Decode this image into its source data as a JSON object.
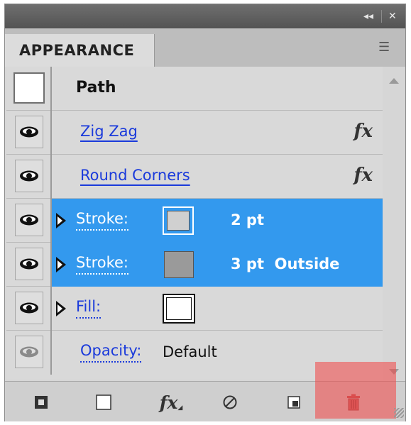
{
  "panel": {
    "collapse_glyph": "◂◂",
    "close_glyph": "✕",
    "tab_label": "APPEARANCE",
    "menu_glyph": "☰"
  },
  "header": {
    "title": "Path"
  },
  "rows": [
    {
      "kind": "effect",
      "label": "Zig Zag",
      "fx": "fx"
    },
    {
      "kind": "effect",
      "label": "Round Corners",
      "fx": "fx"
    },
    {
      "kind": "stroke",
      "label": "Stroke:",
      "value": "2 pt",
      "swatch": "#d0d0d0",
      "selected": true
    },
    {
      "kind": "stroke",
      "label": "Stroke:",
      "value": "3 pt  Outside",
      "swatch": "#9a9a9a",
      "selected": true
    },
    {
      "kind": "fill",
      "label": "Fill:",
      "swatch": "#ffffff"
    },
    {
      "kind": "opacity",
      "label": "Opacity:",
      "value": "Default"
    }
  ],
  "colors": {
    "selection": "#3399ee",
    "link": "#1a3adb",
    "panel_bg": "#d9d9d9"
  },
  "toolbar": {
    "icons": [
      "add-new-stroke-icon",
      "add-new-fill-icon",
      "add-new-effect-icon",
      "clear-appearance-icon",
      "duplicate-item-icon",
      "delete-item-icon"
    ],
    "fx_glyph": "fx"
  }
}
